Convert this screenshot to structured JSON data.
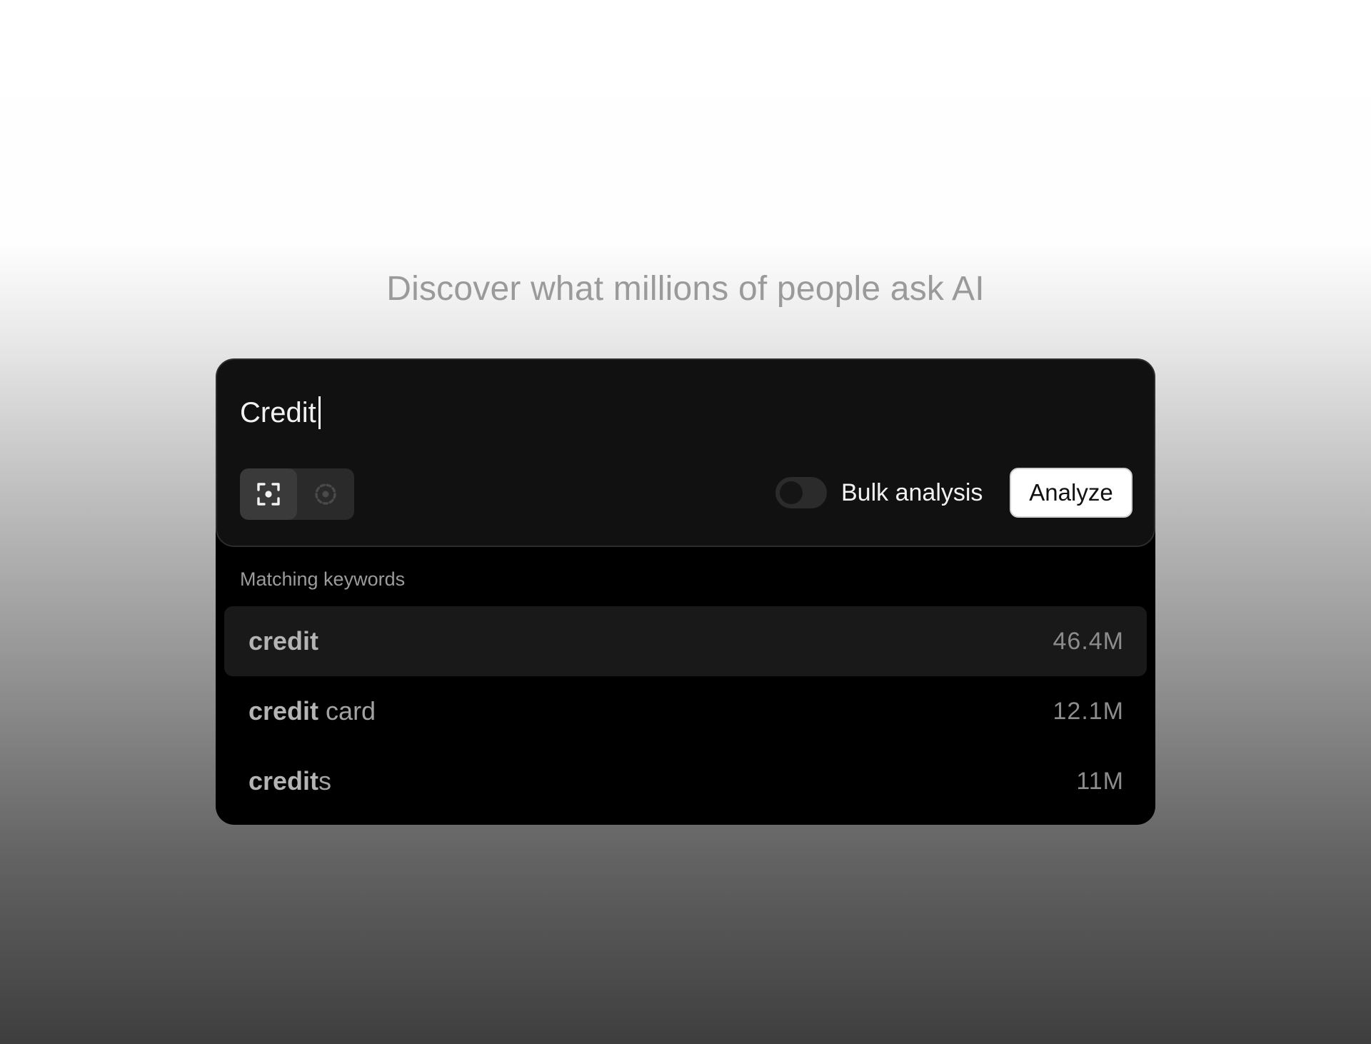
{
  "headline": "Discover what millions of people ask AI",
  "search": {
    "value": "Credit",
    "modes": [
      {
        "icon": "focus-frame-icon",
        "active": true
      },
      {
        "icon": "dotted-circle-icon",
        "active": false
      }
    ],
    "bulk_toggle": {
      "label": "Bulk analysis",
      "on": false
    },
    "analyze_label": "Analyze"
  },
  "dropdown": {
    "title": "Matching keywords",
    "items": [
      {
        "match": "credit",
        "rest": "",
        "count": "46.4M",
        "highlighted": true
      },
      {
        "match": "credit",
        "rest": " card",
        "count": "12.1M",
        "highlighted": false
      },
      {
        "match": "credit",
        "rest": "s",
        "count": "11M",
        "highlighted": false
      }
    ]
  },
  "colors": {
    "card_bg": "#111111",
    "dropdown_bg": "#000000",
    "button_bg": "#ffffff"
  }
}
